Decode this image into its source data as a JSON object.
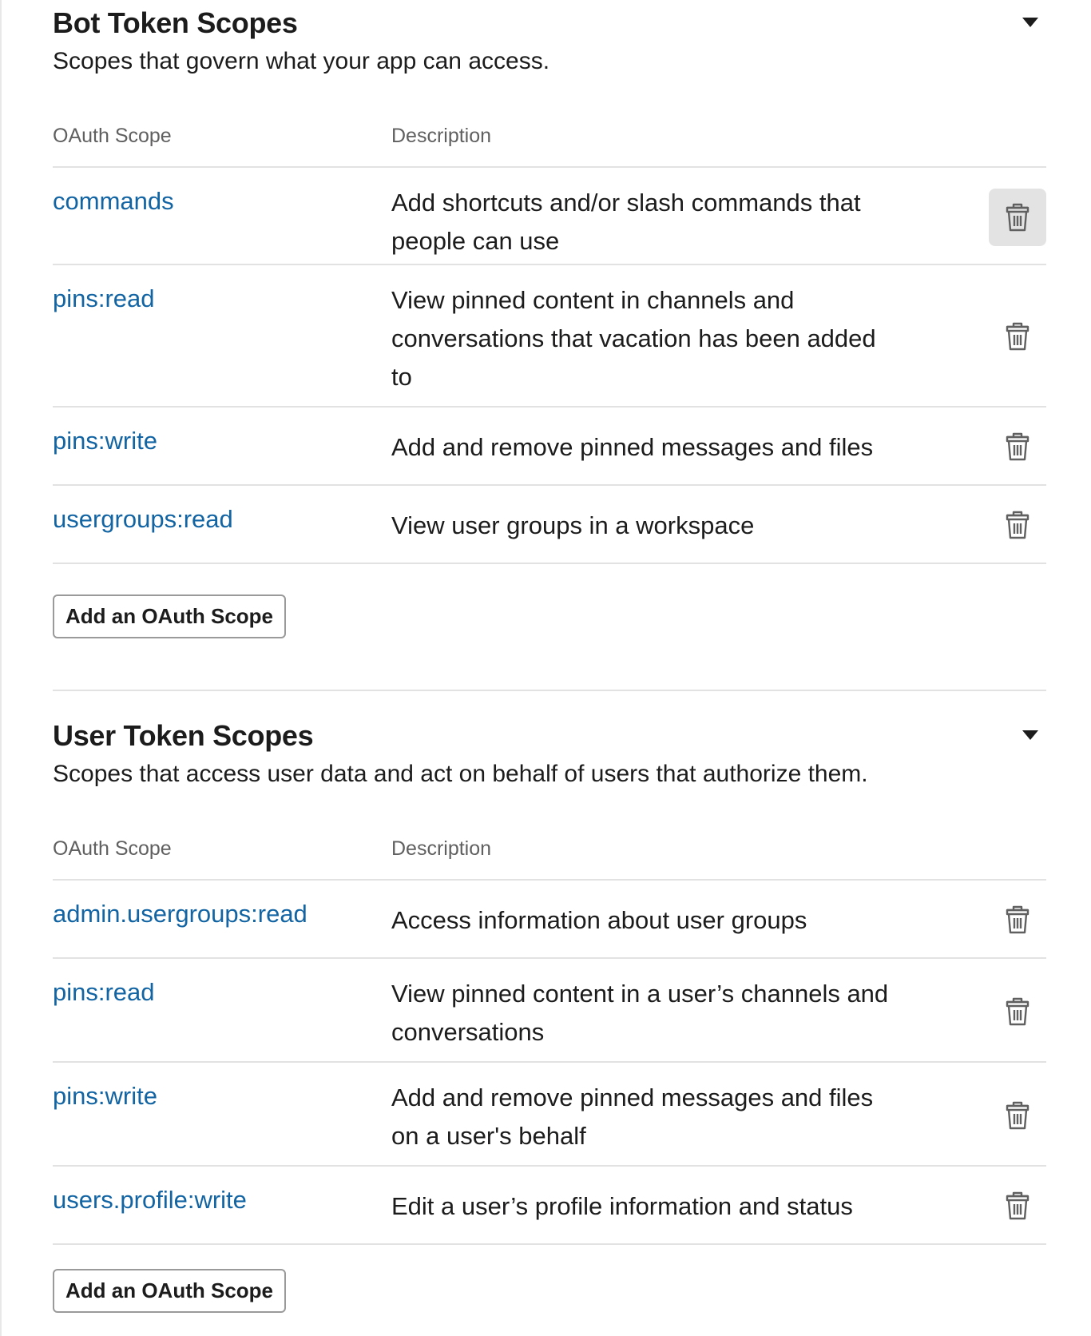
{
  "bot_section": {
    "title": "Bot Token Scopes",
    "subtitle": "Scopes that govern what your app can access.",
    "col_scope": "OAuth Scope",
    "col_description": "Description",
    "rows": [
      {
        "scope": "commands",
        "description": "Add shortcuts and/or slash commands that people can use"
      },
      {
        "scope": "pins:read",
        "description": "View pinned content in channels and conversations that vacation has been added to"
      },
      {
        "scope": "pins:write",
        "description": "Add and remove pinned messages and files"
      },
      {
        "scope": "usergroups:read",
        "description": "View user groups in a workspace"
      }
    ],
    "add_button": "Add an OAuth Scope"
  },
  "user_section": {
    "title": "User Token Scopes",
    "subtitle": "Scopes that access user data and act on behalf of users that authorize them.",
    "col_scope": "OAuth Scope",
    "col_description": "Description",
    "rows": [
      {
        "scope": "admin.usergroups:read",
        "description": "Access information about user groups"
      },
      {
        "scope": "pins:read",
        "description": "View pinned content in a user’s channels and conversations"
      },
      {
        "scope": "pins:write",
        "description": "Add and remove pinned messages and files on a user's behalf"
      },
      {
        "scope": "users.profile:write",
        "description": "Edit a user’s profile information and status"
      }
    ],
    "add_button": "Add an OAuth Scope"
  },
  "icons": {
    "collapse": "caret-down-icon",
    "delete": "trash-icon"
  },
  "colors": {
    "link": "#1264a3",
    "text": "#1d1c1d",
    "muted": "#616061",
    "border": "#e2e2e2",
    "hover_bg": "#e3e3e3"
  }
}
